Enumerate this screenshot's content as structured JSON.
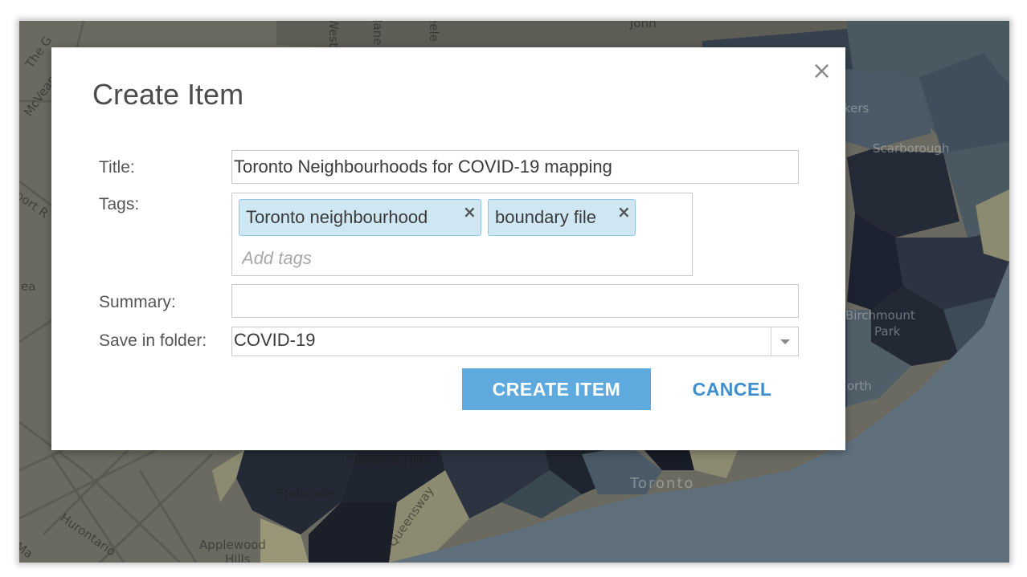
{
  "dialog": {
    "title": "Create Item",
    "close_icon": "×",
    "fields": {
      "title_label": "Title:",
      "title_value": "Toronto Neighbourhoods for COVID-19 mapping",
      "tags_label": "Tags:",
      "tags": [
        {
          "label": "Toronto neighbourhood",
          "remove_icon": "×"
        },
        {
          "label": "boundary file",
          "remove_icon": "×"
        }
      ],
      "tags_placeholder": "Add tags",
      "summary_label": "Summary:",
      "summary_value": "",
      "folder_label": "Save in folder:",
      "folder_value": "COVID-19"
    },
    "buttons": {
      "create": "CREATE ITEM",
      "cancel": "CANCEL"
    }
  },
  "map": {
    "labels": {
      "scarborough": "Scarborough",
      "birchmount": "Birchmount",
      "park": "Park",
      "etobicoke": "Etobicoke",
      "applewood": "Applewood",
      "hills": "Hills",
      "chestnut_hills": "Chestnut Hills",
      "toronto": "Toronto",
      "hurontario": "Hurontario",
      "the_queensway": "The Queensway",
      "north": "orth",
      "ea": "ea",
      "mcveam": "McVean",
      "the_g": "The G",
      "port": "port R",
      "jane": "Jane",
      "weston": "West",
      "keele": "eele",
      "steeles": "Steeles",
      "john": "John",
      "kers": "kers",
      "ma": "Ma"
    },
    "colors": {
      "water": "#5f707c",
      "land_beige": "#6e6e64",
      "dark": "#202530",
      "mid": "#2f3b48",
      "slate": "#3a4a55",
      "tan": "#8c8a70"
    }
  }
}
